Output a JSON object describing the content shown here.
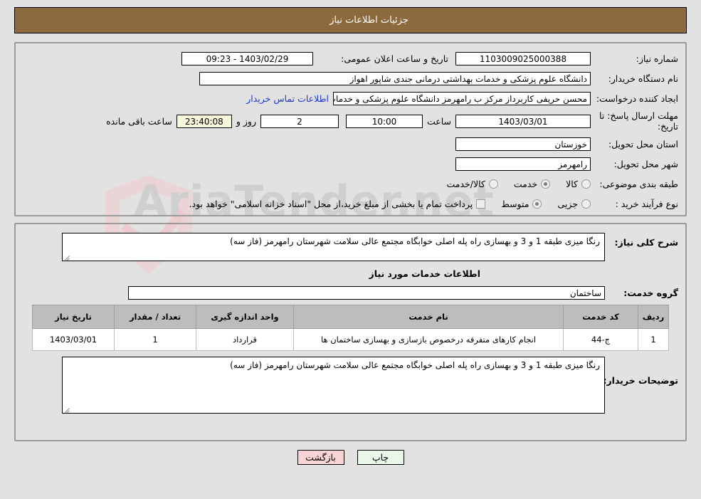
{
  "header": {
    "title": "جزئیات اطلاعات نیاز"
  },
  "need_info": {
    "need_number_label": "شماره نیاز:",
    "need_number_value": "1103009025000388",
    "announce_datetime_label": "تاریخ و ساعت اعلان عمومی:",
    "announce_datetime_value": "09:23 - 1403/02/29",
    "buyer_org_label": "نام دستگاه خریدار:",
    "buyer_org_value": "دانشگاه علوم پزشکی و خدمات بهداشتی درمانی جندی شاپور اهواز",
    "requester_label": "ایجاد کننده درخواست:",
    "requester_value": "محسن حریفی کاربرداز مرکز ب رامهرمز دانشگاه علوم پزشکی و خدمات بهداشتی",
    "buyer_contact_link": "اطلاعات تماس خریدار",
    "deadline_label": "مهلت ارسال پاسخ: تا تاریخ:",
    "deadline_date": "1403/03/01",
    "deadline_hour_label": "ساعت",
    "deadline_hour": "10:00",
    "remaining_days": "2",
    "remaining_days_label": "روز و",
    "remaining_time": "23:40:08",
    "remaining_time_label": "ساعت باقی مانده",
    "province_label": "استان محل تحویل:",
    "province_value": "خوزستان",
    "city_label": "شهر محل تحویل:",
    "city_value": "رامهرمز",
    "category_label": "طبقه بندی موضوعی:",
    "category_options": [
      {
        "label": "کالا",
        "selected": false
      },
      {
        "label": "خدمت",
        "selected": true
      },
      {
        "label": "کالا/خدمت",
        "selected": false
      }
    ],
    "purchase_type_label": "نوع فرآیند خرید :",
    "purchase_type_options": [
      {
        "label": "جزیی",
        "selected": false
      },
      {
        "label": "متوسط",
        "selected": true
      }
    ],
    "treasury_checkbox_note": "پرداخت تمام یا بخشی از مبلغ خرید،از محل \"اسناد خزانه اسلامی\" خواهد بود."
  },
  "need_detail": {
    "summary_label": "شرح کلی نیاز:",
    "summary_value": "رنگا میزی طبقه 1 و 3  و بهسازی راه پله اصلی خوابگاه مجتمع عالی سلامت شهرستان رامهرمز (فاز سه)",
    "services_section_title": "اطلاعات خدمات مورد نیاز",
    "service_group_label": "گروه خدمت:",
    "service_group_value": "ساختمان",
    "table": {
      "columns": [
        "ردیف",
        "کد خدمت",
        "نام خدمت",
        "واحد اندازه گیری",
        "تعداد / مقدار",
        "تاریخ نیاز"
      ],
      "rows": [
        {
          "radif": "1",
          "code": "ج-44",
          "name": "انجام کارهای متفرقه درخصوص بازسازی و بهسازی ساختمان ها",
          "unit": "قرارداد",
          "quantity": "1",
          "need_date": "1403/03/01"
        }
      ]
    },
    "buyer_notes_label": "توضیحات خریدار:",
    "buyer_notes_value": "رنگا میزی طبقه 1 و 3  و بهسازی راه پله اصلی خوابگاه مجتمع عالی سلامت شهرستان رامهرمز (فاز سه)"
  },
  "footer": {
    "print_label": "چاپ",
    "back_label": "بازگشت"
  },
  "watermark": {
    "text": "AriaTender.net"
  },
  "colors": {
    "header_brown": "#8c6a3e",
    "page_background": "#e2e2e2",
    "link_blue": "#1b39d8",
    "countdown_cream": "#f7f7dc",
    "print_green": "#e9f7e9",
    "back_pink": "#f8d4d4",
    "table_header_gray": "#bdbdbd"
  }
}
